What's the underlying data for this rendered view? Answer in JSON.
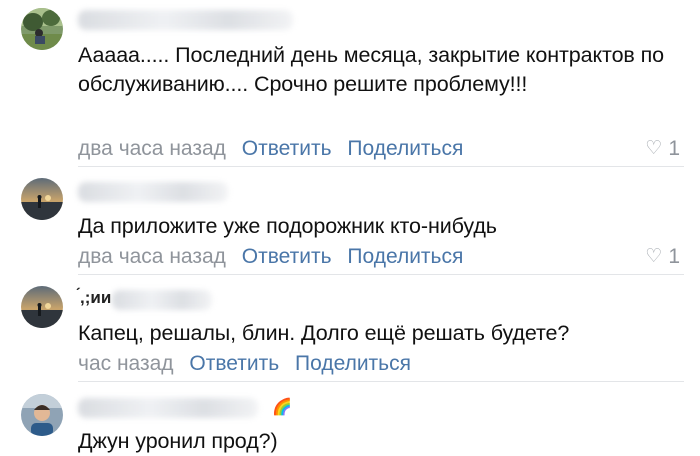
{
  "comments": [
    {
      "text": "Ааааа..... Последний день месяца, закрытие контрактов по обслуживанию.... Срочно решите проблему!!!",
      "time": "два часа назад",
      "reply": "Ответить",
      "share": "Поделиться",
      "likes": "1",
      "avatar": "outdoor-photo"
    },
    {
      "text": "Да приложите уже подорожник кто-нибудь",
      "time": "два часа назад",
      "reply": "Ответить",
      "share": "Поделиться",
      "likes": "1",
      "avatar": "sunset-photo"
    },
    {
      "name_partial": "́,;ии",
      "text": "Капец, решалы, блин. Долго ещё решать будете?",
      "time": "час назад",
      "reply": "Ответить",
      "share": "Поделиться",
      "avatar": "sunset-photo"
    },
    {
      "name_badge": "🌈",
      "text": "Джун уронил прод?)",
      "avatar": "person-photo"
    }
  ],
  "colors": {
    "link": "#4a76a8",
    "muted": "#8f949b",
    "divider": "#e3e5e8"
  },
  "icons": {
    "like": "heart-outline-icon"
  }
}
